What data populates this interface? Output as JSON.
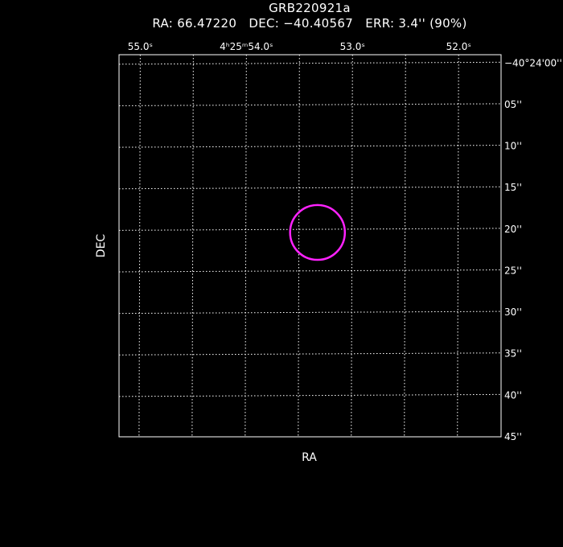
{
  "header": {
    "title": "GRB220921a",
    "subtitle": "RA: 66.47220   DEC: −40.40567   ERR: 3.4'' (90%)"
  },
  "chart_data": {
    "type": "scatter",
    "title": "GRB220921a",
    "subtitle": "RA: 66.47220   DEC: −40.40567   ERR: 3.4'' (90%)",
    "xlabel": "RA",
    "ylabel": "DEC",
    "grid": true,
    "x_axis": {
      "position": "top",
      "unit": "seconds of RA",
      "range": [
        55.2,
        51.6
      ],
      "ticks": [
        {
          "value": 55.0,
          "label": "55.0ˢ"
        },
        {
          "value": 54.0,
          "label": "4ʰ25ᵐ54.0ˢ"
        },
        {
          "value": 53.0,
          "label": "53.0ˢ"
        },
        {
          "value": 52.0,
          "label": "52.0ˢ"
        }
      ],
      "grid_values": [
        55.5,
        55.0,
        54.5,
        54.0,
        53.5,
        53.0,
        52.5,
        52.0,
        51.5
      ]
    },
    "y_axis": {
      "position": "right",
      "unit": "arcseconds below −40°24'00''",
      "range": [
        -1,
        45
      ],
      "ticks": [
        {
          "value": 0,
          "label": "−40°24'00''"
        },
        {
          "value": 5,
          "label": "05''"
        },
        {
          "value": 10,
          "label": "10''"
        },
        {
          "value": 15,
          "label": "15''"
        },
        {
          "value": 20,
          "label": "20''"
        },
        {
          "value": 25,
          "label": "25''"
        },
        {
          "value": 30,
          "label": "30''"
        },
        {
          "value": 35,
          "label": "35''"
        },
        {
          "value": 40,
          "label": "40''"
        },
        {
          "value": 45,
          "label": "45''"
        }
      ]
    },
    "series": [
      {
        "ra_seconds": 53.33,
        "dec_arcsec_offset": 20.4,
        "error_radius_arcsec": 3.4,
        "color": "#ff22ff"
      }
    ]
  }
}
